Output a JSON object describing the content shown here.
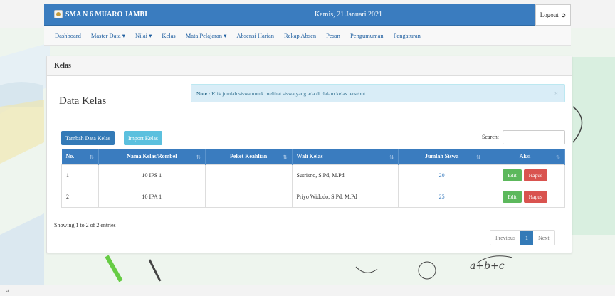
{
  "header": {
    "school_name": "SMA N 6 MUARO JAMBI",
    "date": "Kamis, 21 Januari 2021",
    "logout_label": "Logout"
  },
  "nav": {
    "items": [
      {
        "label": "Dashboard"
      },
      {
        "label": "Master Data ▾"
      },
      {
        "label": "Nilai ▾"
      },
      {
        "label": "Kelas"
      },
      {
        "label": "Mata Pelajaran ▾"
      },
      {
        "label": "Absensi Harian"
      },
      {
        "label": "Rekap Absen"
      },
      {
        "label": "Pesan"
      },
      {
        "label": "Pengumuman"
      },
      {
        "label": "Pengaturan"
      }
    ]
  },
  "panel": {
    "heading": "Kelas",
    "title": "Data Kelas",
    "note_bold": "Note :",
    "note_text": " Klik jumlah siswa untuk melihat siswa yang ada di dalam kelas tersebut",
    "close": "×",
    "add_button": "Tambah Data Kelas",
    "import_button": "Import Kelas",
    "search_label": "Search:",
    "search_value": ""
  },
  "table": {
    "headers": [
      "No.",
      "Nama Kelas/Rombel",
      "Peket Keahlian",
      "Wali Kelas",
      "Jumlah Siswa",
      "Aksi"
    ],
    "rows": [
      {
        "no": "1",
        "kelas": "10 IPS 1",
        "keahlian": "",
        "wali": "Sutrisno, S.Pd, M.Pd",
        "jumlah": "20",
        "edit": "Edit",
        "hapus": "Hapus"
      },
      {
        "no": "2",
        "kelas": "10 IPA 1",
        "keahlian": "",
        "wali": "Priyo Widodo, S.Pd, M.Pd",
        "jumlah": "25",
        "edit": "Edit",
        "hapus": "Hapus"
      }
    ]
  },
  "pagination": {
    "info": "Showing 1 to 2 of 2 entries",
    "previous": "Previous",
    "current": "1",
    "next": "Next"
  },
  "footer": {
    "text": "st"
  },
  "colors": {
    "primary": "#3a7cbf",
    "info_bg": "#d9edf7",
    "success": "#5cb85c",
    "danger": "#d9534f"
  }
}
